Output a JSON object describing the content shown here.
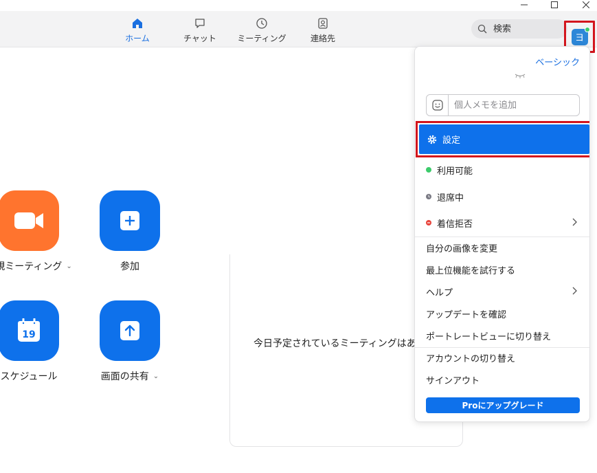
{
  "nav": {
    "tabs": [
      {
        "label": "ホーム",
        "icon": "home-icon",
        "active": true
      },
      {
        "label": "チャット",
        "icon": "chat-icon",
        "active": false
      },
      {
        "label": "ミーティング",
        "icon": "clock-icon",
        "active": false
      },
      {
        "label": "連絡先",
        "icon": "contacts-icon",
        "active": false
      }
    ],
    "search_placeholder": "検索",
    "avatar_initial": "ヨ"
  },
  "home": {
    "actions": [
      {
        "label": "新規ミーティング",
        "icon": "video-camera-icon",
        "color": "#ff742e",
        "dropdown": true
      },
      {
        "label": "参加",
        "icon": "plus-icon",
        "color": "#0e71eb",
        "dropdown": false
      },
      {
        "label": "スケジュール",
        "icon": "calendar-icon",
        "calendar_day": "19",
        "color": "#0e71eb",
        "dropdown": false
      },
      {
        "label": "画面の共有",
        "icon": "share-up-arrow-icon",
        "color": "#0e71eb",
        "dropdown": true
      }
    ],
    "no_meetings_text": "今日予定されているミーティングはありま"
  },
  "menu": {
    "plan": "ベーシック",
    "memo_placeholder": "個人メモを追加",
    "settings": "設定",
    "status": [
      {
        "label": "利用可能",
        "color": "#3ccb6b"
      },
      {
        "label": "退席中",
        "color": "#7a7a84"
      },
      {
        "label": "着信拒否",
        "color": "#e8453c",
        "submenu": true
      }
    ],
    "items": [
      "自分の画像を変更",
      "最上位機能を試行する",
      "ヘルプ",
      "アップデートを確認",
      "ポートレートビューに切り替え"
    ],
    "items2": [
      "アカウントの切り替え",
      "サインアウト"
    ],
    "upgrade": "Proにアップグレード"
  },
  "colors": {
    "accent": "#0e71eb",
    "highlight_border": "#d3151d",
    "orange": "#ff742e"
  }
}
